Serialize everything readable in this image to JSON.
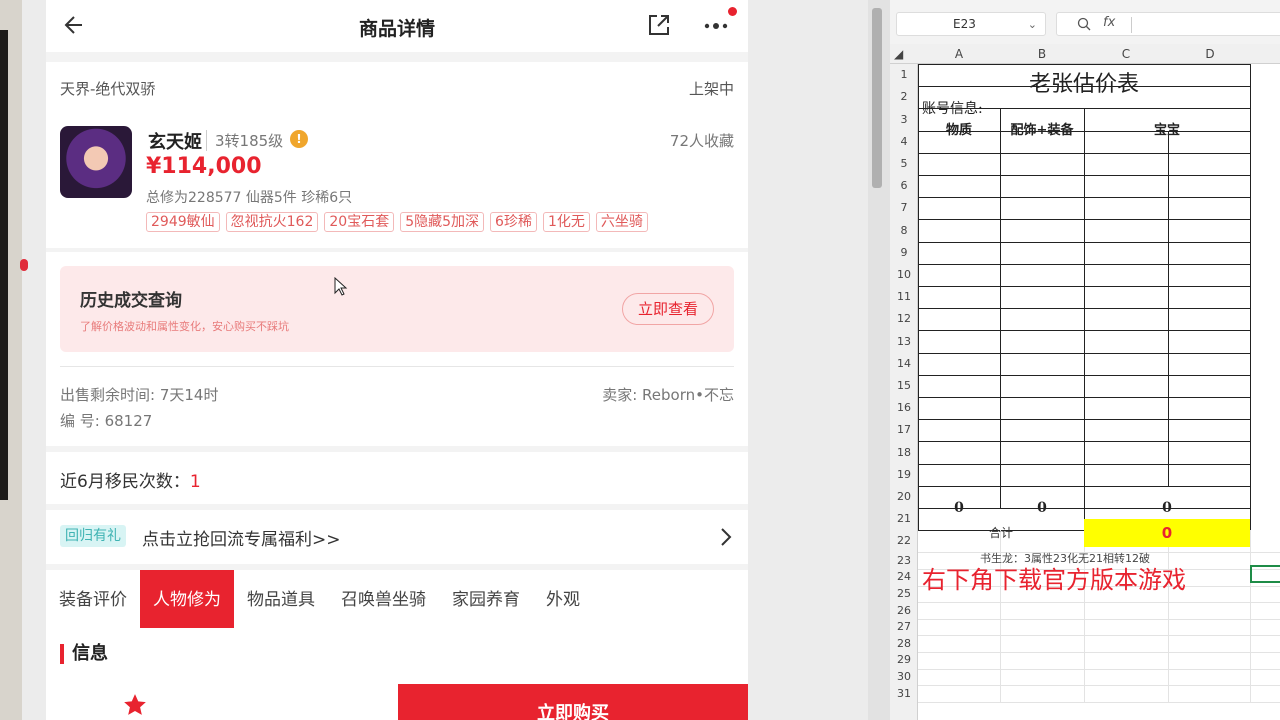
{
  "header": {
    "title": "商品详情"
  },
  "product": {
    "server": "天界-绝代双骄",
    "status": "上架中",
    "name": "玄天姬",
    "level": "3转185级",
    "favorites": "72人收藏",
    "price": "¥114,000",
    "summary": "总修为228577  仙器5件  珍稀6只",
    "tags": [
      "2949敏仙",
      "忽视抗火162",
      "20宝石套",
      "5隐藏5加深",
      "6珍稀",
      "1化无",
      "六坐骑"
    ]
  },
  "history": {
    "title": "历史成交查询",
    "desc": "了解价格波动和属性变化，安心购买不踩坑",
    "button": "立即查看"
  },
  "sale": {
    "time": "出售剩余时间: 7天14时",
    "seller": "卖家: Reborn•不忘",
    "id": "编 号: 68127"
  },
  "migration": {
    "label": "近6月移民次数：",
    "value": "1"
  },
  "promo": {
    "badge": "回归有礼",
    "text": "点击立抢回流专属福利>>"
  },
  "tabs": [
    "装备评价",
    "人物修为",
    "物品道具",
    "召唤兽坐骑",
    "家园养育",
    "外观"
  ],
  "active_tab": "人物修为",
  "section": {
    "title": "信息"
  },
  "bottom": {
    "buy": "立即购买"
  },
  "sheet": {
    "cell_ref": "E23",
    "fx": "fx",
    "columns": [
      "A",
      "B",
      "C",
      "D"
    ],
    "rows": [
      "1",
      "2",
      "3",
      "4",
      "5",
      "6",
      "7",
      "8",
      "9",
      "10",
      "11",
      "12",
      "13",
      "14",
      "15",
      "16",
      "17",
      "18",
      "19",
      "20",
      "21",
      "22",
      "23",
      "24",
      "25",
      "26",
      "27",
      "28",
      "29",
      "30",
      "31"
    ],
    "title": "老张估价表",
    "account_label": "账号信息:",
    "headers": [
      "物质",
      "配饰+装备",
      "宝宝"
    ],
    "zeros": [
      "0",
      "0",
      "0"
    ],
    "total_label": "合计",
    "total_value": "0",
    "note": "书生龙：3属性23化无21相转12破",
    "overlay": "右下角下载官方版本游戏"
  }
}
